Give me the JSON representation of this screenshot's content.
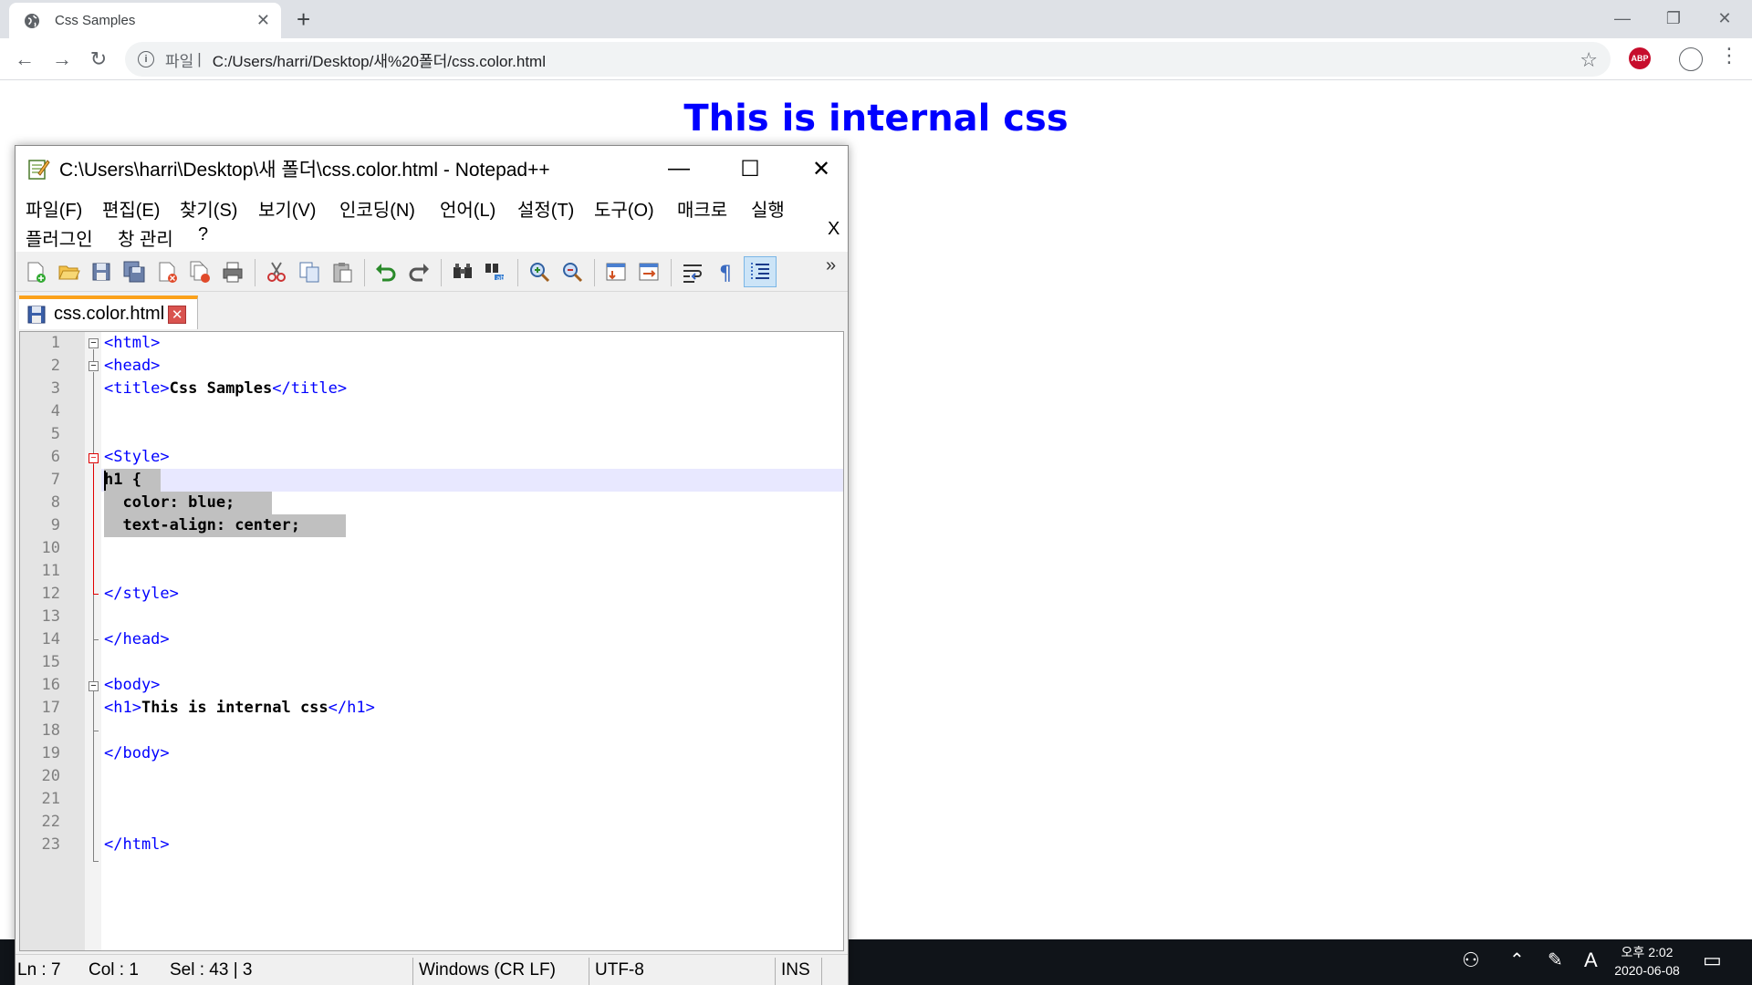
{
  "browser": {
    "tab_title": "Css Samples",
    "new_tab": "+",
    "address_label": "파일",
    "address_sep": "|",
    "url": "C:/Users/harri/Desktop/새%20폴더/css.color.html",
    "abp": "ABP"
  },
  "page": {
    "heading": "This is internal css",
    "heading_color": "#0000ff"
  },
  "npp": {
    "title": "C:\\Users\\harri\\Desktop\\새 폴더\\css.color.html - Notepad++",
    "menu": [
      "파일(F)",
      "편집(E)",
      "찾기(S)",
      "보기(V)",
      "인코딩(N)",
      "언어(L)",
      "설정(T)",
      "도구(O)",
      "매크로",
      "실행",
      "플러그인",
      "창 관리",
      "?"
    ],
    "menu_close": "X",
    "file_tab": "css.color.html",
    "lines": [
      {
        "n": "1",
        "code": "<html>"
      },
      {
        "n": "2",
        "code": "<head>"
      },
      {
        "n": "3",
        "code": "<title>Css Samples</title>"
      },
      {
        "n": "4",
        "code": ""
      },
      {
        "n": "5",
        "code": ""
      },
      {
        "n": "6",
        "code": "<Style>"
      },
      {
        "n": "7",
        "code": "h1 {"
      },
      {
        "n": "8",
        "code": "  color: blue;"
      },
      {
        "n": "9",
        "code": "  text-align: center;"
      },
      {
        "n": "10",
        "code": ""
      },
      {
        "n": "11",
        "code": ""
      },
      {
        "n": "12",
        "code": "</style>"
      },
      {
        "n": "13",
        "code": ""
      },
      {
        "n": "14",
        "code": "</head>"
      },
      {
        "n": "15",
        "code": ""
      },
      {
        "n": "16",
        "code": "<body>"
      },
      {
        "n": "17",
        "code": "<h1>This is internal css</h1>"
      },
      {
        "n": "18",
        "code": ""
      },
      {
        "n": "19",
        "code": "</body>"
      },
      {
        "n": "20",
        "code": ""
      },
      {
        "n": "21",
        "code": ""
      },
      {
        "n": "22",
        "code": ""
      },
      {
        "n": "23",
        "code": "</html>"
      }
    ],
    "status": {
      "ln": "Ln : 7",
      "col": "Col : 1",
      "sel": "Sel : 43 | 3",
      "eol": "Windows (CR LF)",
      "enc": "UTF-8",
      "mode": "INS"
    }
  },
  "taskbar": {
    "time": "오후 2:02",
    "date": "2020-06-08",
    "ime": "A"
  },
  "icons": [
    "globe-icon",
    "close-icon",
    "back-icon",
    "forward-icon",
    "reload-icon",
    "info-icon",
    "star-icon",
    "abp-icon",
    "profile-icon",
    "menu-icon",
    "notepad-icon",
    "minimize-icon",
    "maximize-icon",
    "save-icon",
    "tab-close-icon",
    "people-icon",
    "chevron-up-icon",
    "pen-icon",
    "notification-icon"
  ]
}
